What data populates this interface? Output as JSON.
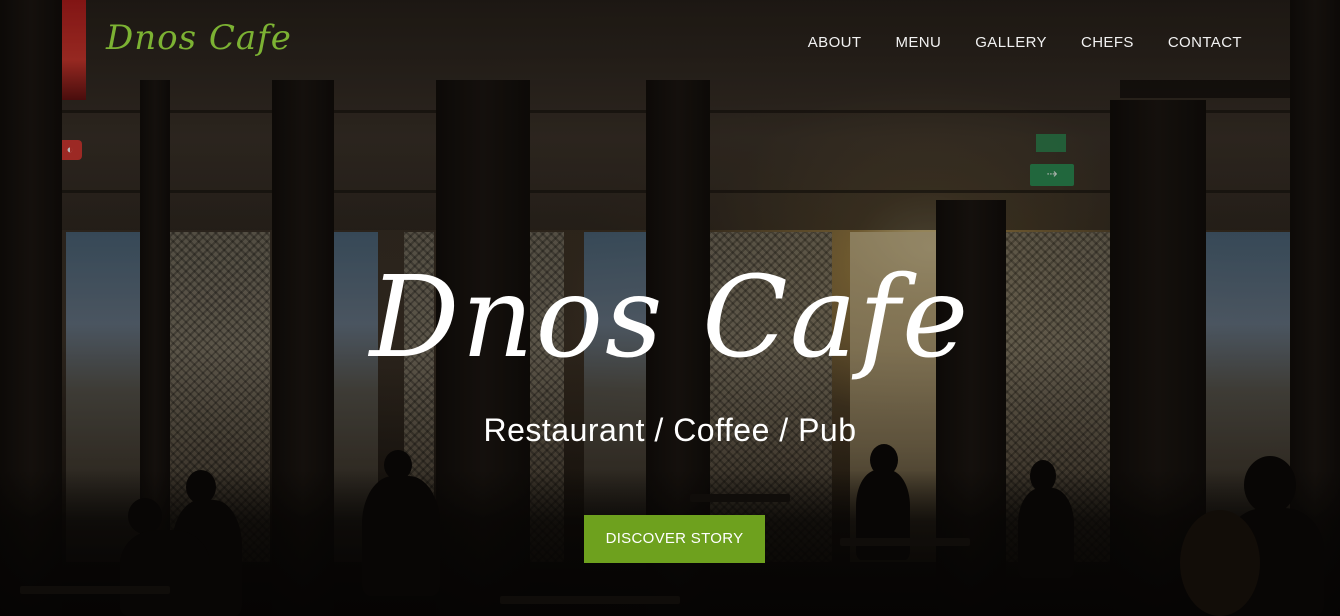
{
  "brand": {
    "logo_text": "Dnos Cafe",
    "accent_color": "#6ea11e",
    "logo_color": "#7cb233"
  },
  "nav": {
    "items": [
      {
        "label": "ABOUT"
      },
      {
        "label": "MENU"
      },
      {
        "label": "GALLERY"
      },
      {
        "label": "CHEFS"
      },
      {
        "label": "CONTACT"
      }
    ]
  },
  "hero": {
    "title": "Dnos Cafe",
    "subtitle": "Restaurant / Coffee / Pub",
    "cta_label": "DISCOVER STORY",
    "background": "restaurant-interior-sunset-photo"
  }
}
